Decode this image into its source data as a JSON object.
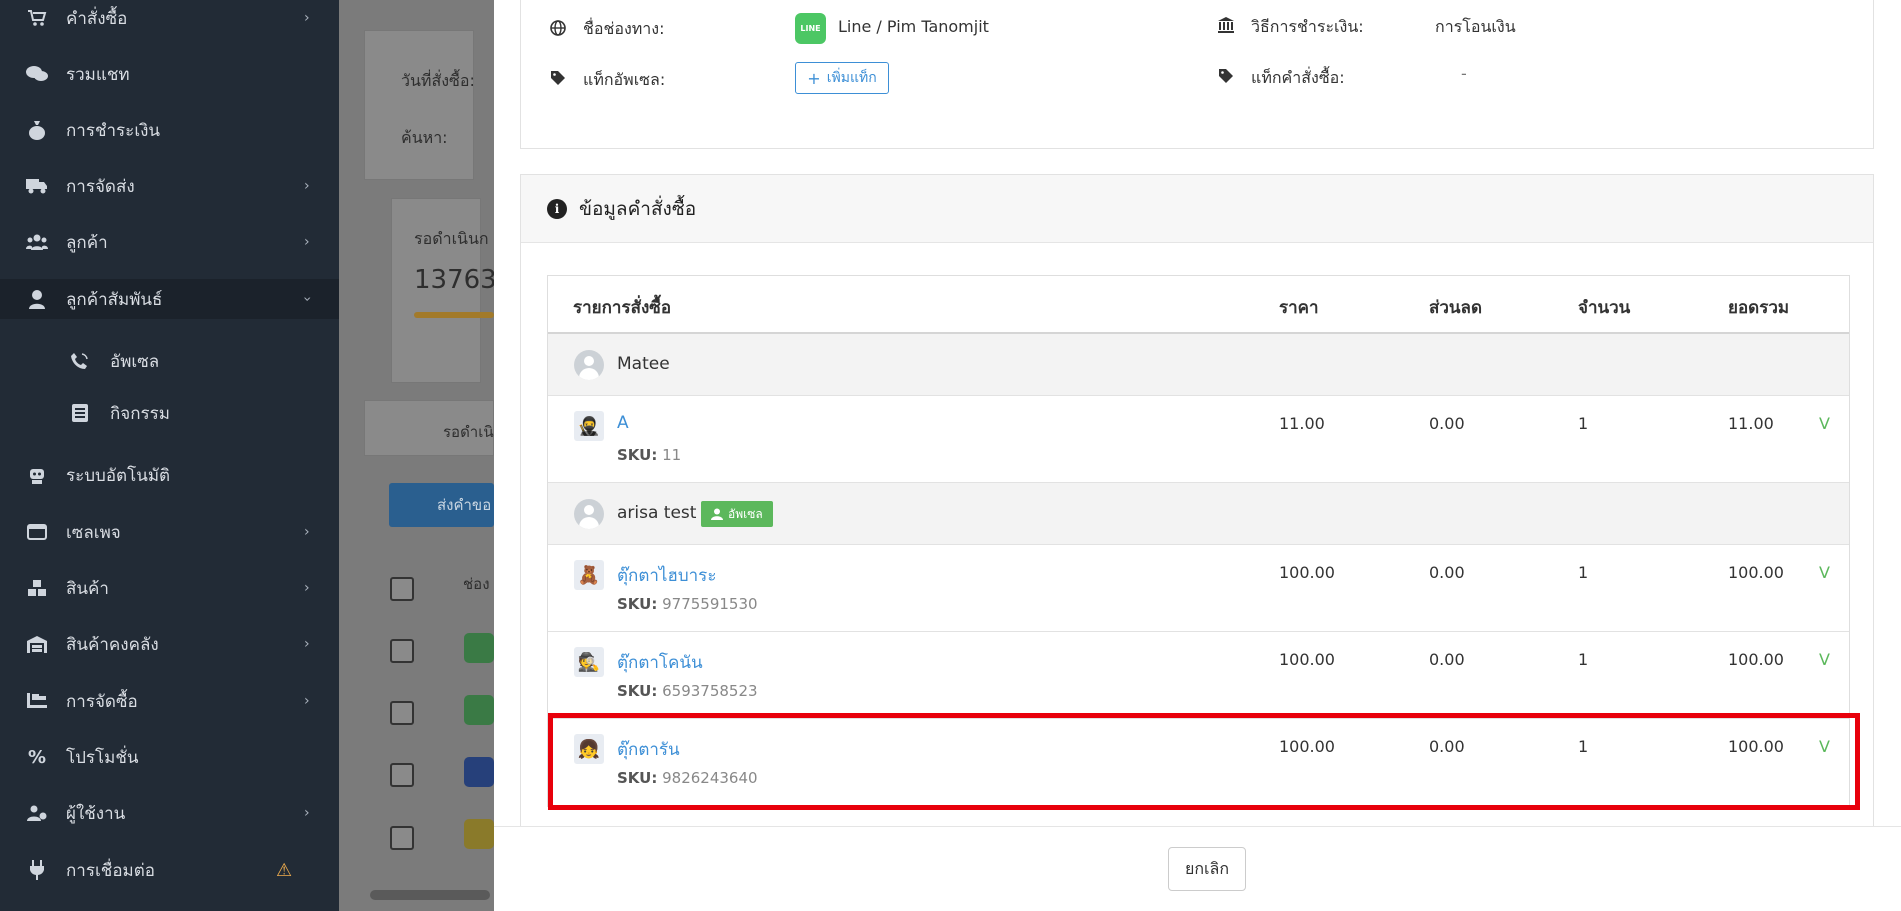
{
  "sidebar": {
    "items": [
      {
        "label": "คำสั่งซื้อ",
        "icon": "cart-icon",
        "chevron": true
      },
      {
        "label": "รวมแชท",
        "icon": "chat-icon",
        "chevron": false
      },
      {
        "label": "การชำระเงิน",
        "icon": "money-bag-icon",
        "chevron": false
      },
      {
        "label": "การจัดส่ง",
        "icon": "truck-icon",
        "chevron": true
      },
      {
        "label": "ลูกค้า",
        "icon": "users-icon",
        "chevron": true
      },
      {
        "label": "ลูกค้าสัมพันธ์",
        "icon": "user-tie-icon",
        "chevron": true,
        "expanded": true
      },
      {
        "label": "ระบบอัตโนมัติ",
        "icon": "robot-icon",
        "chevron": false
      },
      {
        "label": "เซลเพจ",
        "icon": "window-icon",
        "chevron": true
      },
      {
        "label": "สินค้า",
        "icon": "boxes-icon",
        "chevron": true
      },
      {
        "label": "สินค้าคงคลัง",
        "icon": "warehouse-icon",
        "chevron": true
      },
      {
        "label": "การจัดซื้อ",
        "icon": "dolly-icon",
        "chevron": true
      },
      {
        "label": "โปรโมชั่น",
        "icon": "percent-icon",
        "chevron": false
      },
      {
        "label": "ผู้ใช้งาน",
        "icon": "users-cog-icon",
        "chevron": true
      },
      {
        "label": "การเชื่อมต่อ",
        "icon": "plug-icon",
        "chevron": false,
        "warning": true
      }
    ],
    "subitems": [
      {
        "label": "อัพเซล",
        "icon": "phone-volume-icon"
      },
      {
        "label": "กิจกรรม",
        "icon": "list-icon"
      }
    ]
  },
  "background": {
    "date_label": "วันที่สั่งซื้อ:",
    "search_label": "ค้นหา:",
    "pending_label": "รอดำเนินก",
    "pending_count": "13763",
    "tab_label": "รอดำเนิน",
    "button_label": "ส่งคำขอ",
    "col_label": "ช่อง"
  },
  "info": {
    "channel_label": "ชื่อช่องทาง:",
    "channel_value": "Line / Pim Tanomjit",
    "payment_label": "วิธีการชำระเงิน:",
    "payment_value": "การโอนเงิน",
    "upsell_tag_label": "แท็กอัพเซล:",
    "add_tag_label": "เพิ่มแท็ก",
    "order_tag_label": "แท็กคำสั่งซื้อ:",
    "order_tag_value": "-",
    "line_badge": "LINE"
  },
  "order": {
    "title": "ข้อมูลคำสั่งซื้อ",
    "columns": {
      "item": "รายการสั่งซื้อ",
      "price": "ราคา",
      "discount": "ส่วนลด",
      "qty": "จำนวน",
      "total": "ยอดรวม"
    },
    "groups": [
      {
        "name": "Matee",
        "badge": null,
        "items": [
          {
            "name": "A",
            "sku_label": "SKU:",
            "sku": "11",
            "price": "11.00",
            "discount": "0.00",
            "qty": "1",
            "total": "11.00",
            "mark": "V"
          }
        ]
      },
      {
        "name": "arisa test",
        "badge": "อัพเซล",
        "items": [
          {
            "name": "ตุ๊กตาไฮบาระ",
            "sku_label": "SKU:",
            "sku": "9775591530",
            "price": "100.00",
            "discount": "0.00",
            "qty": "1",
            "total": "100.00",
            "mark": "V"
          },
          {
            "name": "ตุ๊กตาโคนัน",
            "sku_label": "SKU:",
            "sku": "6593758523",
            "price": "100.00",
            "discount": "0.00",
            "qty": "1",
            "total": "100.00",
            "mark": "V"
          },
          {
            "name": "ตุ๊กตารัน",
            "sku_label": "SKU:",
            "sku": "9826243640",
            "price": "100.00",
            "discount": "0.00",
            "qty": "1",
            "total": "100.00",
            "mark": "V"
          }
        ]
      }
    ]
  },
  "footer": {
    "cancel_label": "ยกเลิก"
  },
  "colors": {
    "link": "#3d8fd6",
    "success": "#5cb85c",
    "highlight": "#e8000b",
    "sidebar_bg": "#222b36"
  }
}
